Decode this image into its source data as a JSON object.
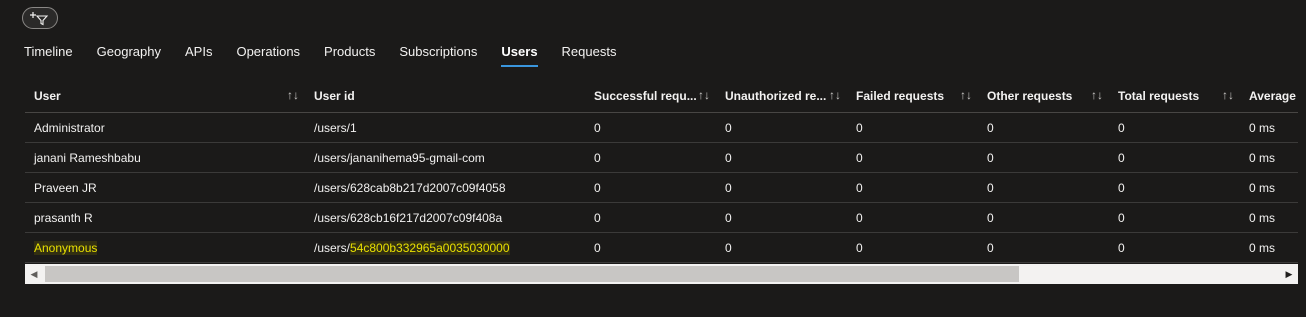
{
  "toolbar": {
    "filter_icon": "add-filter-icon"
  },
  "tabs": [
    {
      "label": "Timeline"
    },
    {
      "label": "Geography"
    },
    {
      "label": "APIs"
    },
    {
      "label": "Operations"
    },
    {
      "label": "Products"
    },
    {
      "label": "Subscriptions"
    },
    {
      "label": "Users",
      "active": true
    },
    {
      "label": "Requests"
    }
  ],
  "table": {
    "columns": [
      {
        "label": "User"
      },
      {
        "label": "User id"
      },
      {
        "label": "Successful requ..."
      },
      {
        "label": "Unauthorized re..."
      },
      {
        "label": "Failed requests"
      },
      {
        "label": "Other requests"
      },
      {
        "label": "Total requests"
      },
      {
        "label": "Average"
      }
    ],
    "rows": [
      {
        "user": "Administrator",
        "user_id": "/users/1",
        "successful": "0",
        "unauthorized": "0",
        "failed": "0",
        "other": "0",
        "total": "0",
        "average": "0 ms"
      },
      {
        "user": "janani Rameshbabu",
        "user_id": "/users/jananihema95-gmail-com",
        "successful": "0",
        "unauthorized": "0",
        "failed": "0",
        "other": "0",
        "total": "0",
        "average": "0 ms"
      },
      {
        "user": "Praveen JR",
        "user_id": "/users/628cab8b217d2007c09f4058",
        "successful": "0",
        "unauthorized": "0",
        "failed": "0",
        "other": "0",
        "total": "0",
        "average": "0 ms"
      },
      {
        "user": "prasanth R",
        "user_id": "/users/628cb16f217d2007c09f408a",
        "successful": "0",
        "unauthorized": "0",
        "failed": "0",
        "other": "0",
        "total": "0",
        "average": "0 ms"
      },
      {
        "user": "Anonymous",
        "user_id_prefix": "/users/",
        "user_id_highlight": "54c800b332965a0035030000",
        "successful": "0",
        "unauthorized": "0",
        "failed": "0",
        "other": "0",
        "total": "0",
        "average": "0 ms"
      }
    ]
  },
  "colors": {
    "background": "#1b1a19",
    "accent": "#3a96dd",
    "highlight": "#e8e000"
  }
}
